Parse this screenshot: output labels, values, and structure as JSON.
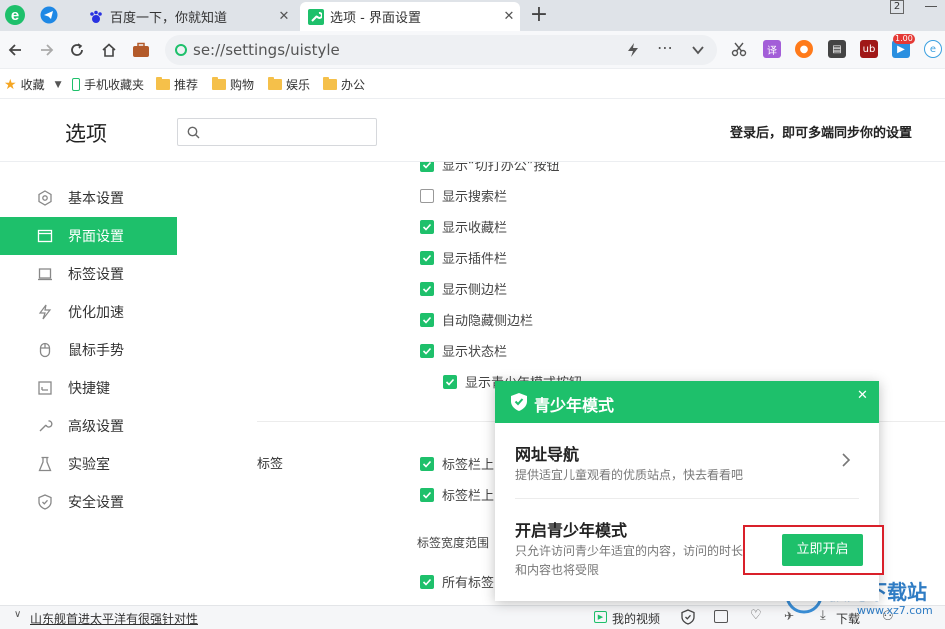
{
  "tabs": [
    {
      "title": "",
      "icon": "browser-logo-icon"
    },
    {
      "title": "",
      "icon": "paper-plane-icon"
    },
    {
      "title": "百度一下，你就知道",
      "close": "✕"
    },
    {
      "title": "选项 - 界面设置",
      "close": "✕"
    }
  ],
  "tab_new": "+",
  "tab_counter": "2",
  "address": {
    "url": "se://settings/uistyle"
  },
  "bookmarks": {
    "favorites": "收藏",
    "items": [
      "手机收藏夹",
      "推荐",
      "购物",
      "娱乐",
      "办公"
    ]
  },
  "extensions": {
    "badge": "1.00"
  },
  "page": {
    "title": "选项",
    "search_placeholder": "",
    "sync_text": "登录后，即可多端同步你的设置"
  },
  "sidebar": {
    "items": [
      {
        "label": "基本设置",
        "icon": "settings-icon"
      },
      {
        "label": "界面设置",
        "icon": "window-icon",
        "active": true
      },
      {
        "label": "标签设置",
        "icon": "tab-icon"
      },
      {
        "label": "优化加速",
        "icon": "lightning-icon"
      },
      {
        "label": "鼠标手势",
        "icon": "mouse-icon"
      },
      {
        "label": "快捷键",
        "icon": "keyboard-icon"
      },
      {
        "label": "高级设置",
        "icon": "wrench-icon"
      },
      {
        "label": "实验室",
        "icon": "flask-icon"
      },
      {
        "label": "安全设置",
        "icon": "shield-icon"
      }
    ]
  },
  "content": {
    "top_partial": "显示“切打办公”按钮",
    "checkboxes": [
      {
        "label": "显示搜索栏",
        "checked": false
      },
      {
        "label": "显示收藏栏",
        "checked": true
      },
      {
        "label": "显示插件栏",
        "checked": true
      },
      {
        "label": "显示侧边栏",
        "checked": true
      },
      {
        "label": "自动隐藏侧边栏",
        "checked": true
      },
      {
        "label": "显示状态栏",
        "checked": true
      }
    ],
    "sub_checkbox": {
      "label": "显示青少年模式按钮",
      "checked": true
    },
    "section_label": "标签",
    "tab_checkbox_1": "标签栏上",
    "tab_checkbox_2": "标签栏上",
    "tab_width_label": "标签宽度范围",
    "all_tabs_label": "所有标签"
  },
  "popup": {
    "title": "青少年模式",
    "close": "✕",
    "nav": {
      "title": "网址导航",
      "desc": "提供适宜儿童观看的优质站点，快去看看吧"
    },
    "mode": {
      "title": "开启青少年模式",
      "desc_line1": "只允许访问青少年适宜的内容，访问的时长",
      "desc_line2": "和内容也将受限",
      "button": "立即开启"
    },
    "highlight_color": "#d9202a"
  },
  "statusbar": {
    "news": "山东舰首进太平洋有很强针对性",
    "video": "我的视频",
    "download": "下载"
  },
  "watermark": {
    "text": "极光下载站",
    "url": "www.xz7.com"
  },
  "colors": {
    "accent": "#1ec06b",
    "highlight": "#d9202a"
  }
}
